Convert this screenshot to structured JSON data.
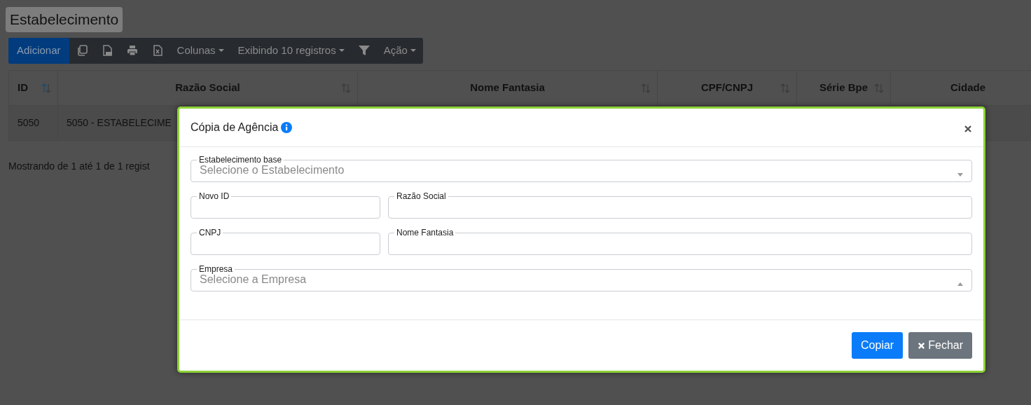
{
  "page_title": "Estabelecimento",
  "toolbar": {
    "items": [
      {
        "kind": "button",
        "label": "Adicionar"
      },
      {
        "kind": "copy"
      },
      {
        "kind": "pdf"
      },
      {
        "kind": "print"
      },
      {
        "kind": "excel"
      },
      {
        "kind": "dropdown",
        "label": "Colunas"
      },
      {
        "kind": "dropdown",
        "label": "Exibindo 10 registros"
      },
      {
        "kind": "filter"
      },
      {
        "kind": "dropdown",
        "label": "Ação"
      }
    ]
  },
  "table": {
    "columns": [
      {
        "label": "ID",
        "sortable": true,
        "sorted": true
      },
      {
        "label": "Razão Social",
        "sortable": true,
        "sorted": false
      },
      {
        "label": "Nome Fantasia",
        "sortable": true,
        "sorted": false
      },
      {
        "label": "CPF/CNPJ",
        "sortable": true,
        "sorted": false
      },
      {
        "label": "Série Bpe",
        "sortable": true,
        "sorted": false
      },
      {
        "label": "Cidade"
      }
    ],
    "rows": [
      [
        "5050",
        "5050 - ESTABELECIME"
      ]
    ]
  },
  "table_info": "Mostrando de 1 até 1 de 1 regist",
  "modal": {
    "title": "Cópia de Agência",
    "fields": [
      [
        {
          "kind": "select",
          "label": "Estabelecimento base",
          "placeholder": "Selecione o Estabelecimento",
          "expanded": false
        }
      ],
      [
        {
          "kind": "text",
          "label": "Novo ID"
        },
        {
          "kind": "text",
          "label": "Razão Social"
        }
      ],
      [
        {
          "kind": "text",
          "label": "CNPJ"
        },
        {
          "kind": "text",
          "label": "Nome Fantasia"
        }
      ],
      [
        {
          "kind": "select",
          "label": "Empresa",
          "placeholder": "Selecione a Empresa",
          "expanded": true
        }
      ]
    ],
    "buttons": [
      {
        "kind": "primary",
        "label": "Copiar"
      },
      {
        "kind": "close",
        "label": "Fechar"
      }
    ]
  }
}
